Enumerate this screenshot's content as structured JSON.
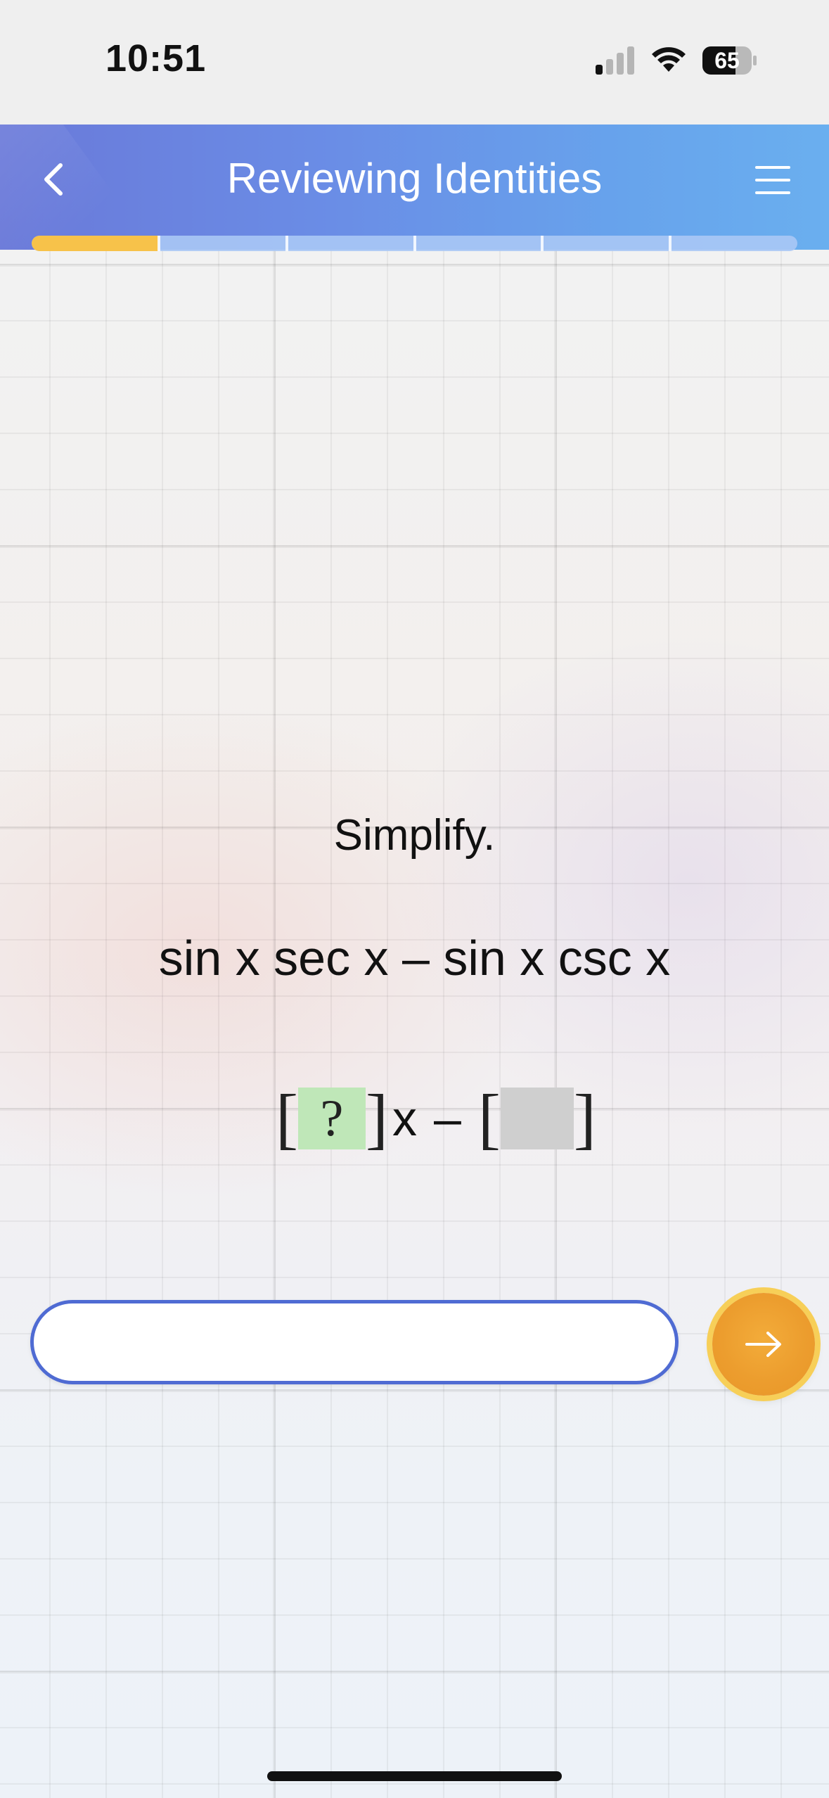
{
  "status_bar": {
    "time": "10:51",
    "battery": "65"
  },
  "header": {
    "title": "Reviewing Identities"
  },
  "progress": {
    "fraction": 0.165,
    "segments": 6
  },
  "question": {
    "prompt": "Simplify.",
    "expression": "sin x sec x – sin x csc x",
    "answer_template": {
      "first_blank": "?",
      "variable": "x",
      "operator": "–"
    }
  },
  "input": {
    "value": "",
    "placeholder": ""
  },
  "colors": {
    "header_start": "#6a79d9",
    "header_end": "#6aafef",
    "progress_fill": "#f7c24a",
    "submit_button": "#ec9d2e",
    "input_border": "#4f6bd3",
    "blank_active": "#bfe7b8",
    "blank_inactive": "#cfcfcf"
  },
  "icons": {
    "back": "chevron-left-icon",
    "menu": "hamburger-menu-icon",
    "submit": "arrow-right-icon"
  }
}
